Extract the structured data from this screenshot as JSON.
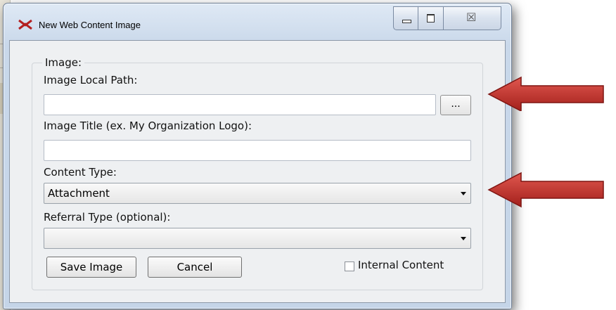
{
  "window": {
    "title": "New Web Content Image",
    "close_glyph": "☒"
  },
  "form": {
    "group_label": "Image:",
    "local_path_label": "Image Local Path:",
    "local_path_value": "",
    "browse_label": "...",
    "title_label": "Image Title (ex. My Organization Logo):",
    "title_value": "",
    "content_type_label": "Content Type:",
    "content_type_value": "Attachment",
    "referral_type_label": "Referral Type (optional):",
    "referral_type_value": "",
    "internal_content_label": "Internal Content",
    "internal_content_checked": false
  },
  "buttons": {
    "save": "Save Image",
    "cancel": "Cancel"
  },
  "annotations": {
    "arrow_color": "#c8322b"
  }
}
